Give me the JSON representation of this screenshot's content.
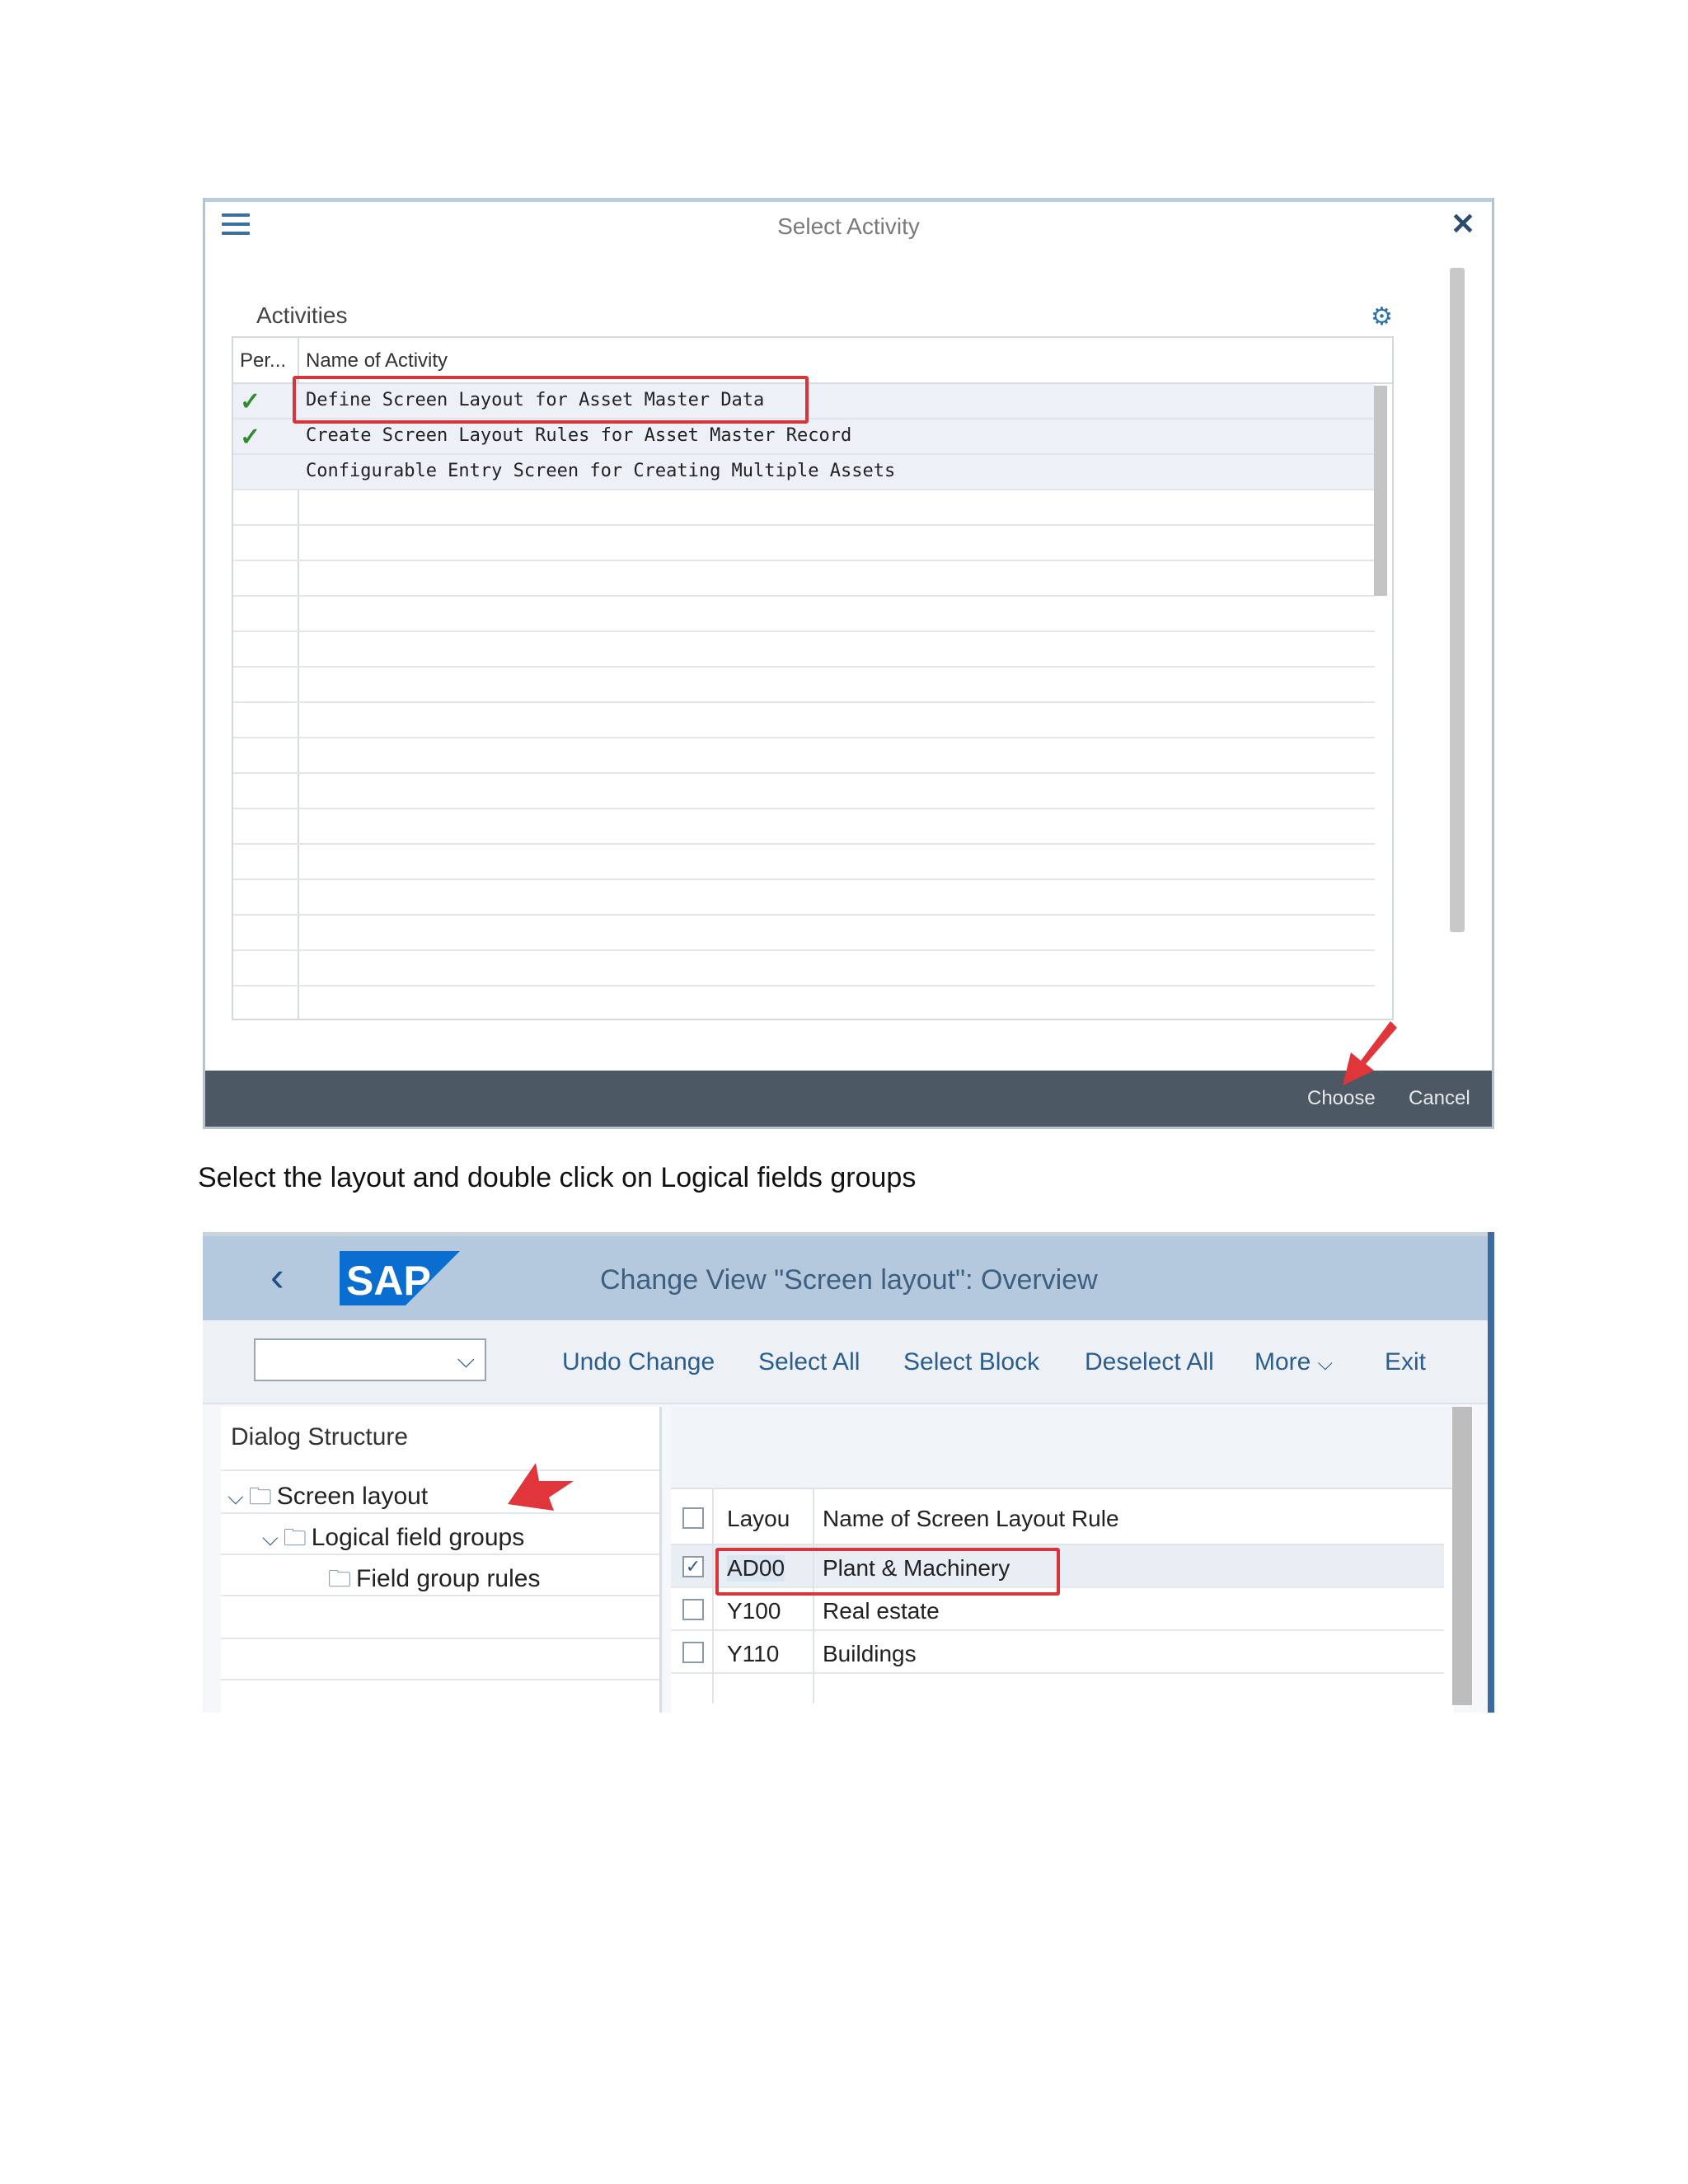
{
  "dialog": {
    "title": "Select Activity",
    "section_label": "Activities",
    "icons": {
      "menu": "hamburger-menu-icon",
      "close": "close-icon",
      "settings": "gear-icon"
    },
    "columns": [
      "Per...",
      "Name of Activity"
    ],
    "rows": [
      {
        "performed": "✓",
        "name": "Define Screen Layout for Asset Master Data"
      },
      {
        "performed": "✓",
        "name": "Create Screen Layout Rules for Asset Master Record"
      },
      {
        "performed": "",
        "name": "Configurable Entry Screen for Creating Multiple Assets"
      }
    ],
    "buttons": {
      "choose": "Choose",
      "cancel": "Cancel"
    }
  },
  "caption": "Select the layout and double click on Logical fields groups",
  "sap_screen": {
    "logo": "SAP",
    "title": "Change View \"Screen layout\": Overview",
    "toolbar": {
      "dropdown_value": "",
      "undo": "Undo Change",
      "select_all": "Select All",
      "select_block": "Select Block",
      "deselect_all": "Deselect All",
      "more": "More",
      "exit": "Exit"
    },
    "dialog_structure": {
      "title": "Dialog Structure",
      "nodes": [
        "Screen layout",
        "Logical field groups",
        "Field group rules"
      ]
    },
    "grid": {
      "columns": [
        "Layou",
        "Name of Screen Layout Rule"
      ],
      "rows": [
        {
          "checked": "✓",
          "code": "AD00",
          "name": "Plant & Machinery"
        },
        {
          "checked": "",
          "code": "Y100",
          "name": "Real estate"
        },
        {
          "checked": "",
          "code": "Y110",
          "name": "Buildings"
        }
      ]
    }
  },
  "colors": {
    "highlight": "#d9343a",
    "sap_blue": "#0a6ed1",
    "title_bar": "#b4c9dd",
    "footer": "#4c5863"
  }
}
